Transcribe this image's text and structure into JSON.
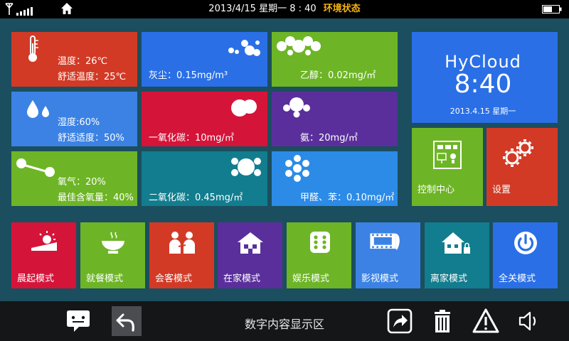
{
  "status_bar": {
    "datetime": "2013/4/15  星期一   8 : 40",
    "title": "环境状态"
  },
  "sensors": {
    "temperature": {
      "line1": "温度：26℃",
      "line2": "舒适温度：25℃"
    },
    "dust": {
      "label": "灰尘：0.15mg/m³"
    },
    "ethanol": {
      "label": "乙醇：0.02mg/㎡"
    },
    "humidity": {
      "line1": "湿度:60%",
      "line2": "舒适适度：50%"
    },
    "co": {
      "label": "一氧化碳：10mg/㎡"
    },
    "ammonia": {
      "label": "氨：20mg/㎡"
    },
    "oxygen": {
      "line1": "氧气：20%",
      "line2": "最佳含氧量：40%"
    },
    "co2": {
      "label": "二氧化碳：0.45mg/㎡"
    },
    "formaldehyde": {
      "label": "甲醛、苯：0.10mg/㎡"
    }
  },
  "cloud": {
    "brand": "HyCloud",
    "time": "8:40",
    "date": "2013.4.15 星期一"
  },
  "control_center": {
    "label": "控制中心"
  },
  "settings": {
    "label": "设置"
  },
  "modes": [
    {
      "label": "晨起模式",
      "color": "#d5143a"
    },
    {
      "label": "就餐模式",
      "color": "#6db526"
    },
    {
      "label": "会客模式",
      "color": "#d23a26"
    },
    {
      "label": "在家模式",
      "color": "#5a2f9c"
    },
    {
      "label": "娱乐模式",
      "color": "#6db526"
    },
    {
      "label": "影视模式",
      "color": "#3b82e4"
    },
    {
      "label": "离家模式",
      "color": "#127d8e"
    },
    {
      "label": "全关模式",
      "color": "#2a6fe6"
    }
  ],
  "bottom_bar": {
    "display_text": "数字内容显示区",
    "icons": [
      "message-icon",
      "back-icon",
      "share-icon",
      "trash-icon",
      "warning-icon",
      "volume-icon"
    ]
  }
}
